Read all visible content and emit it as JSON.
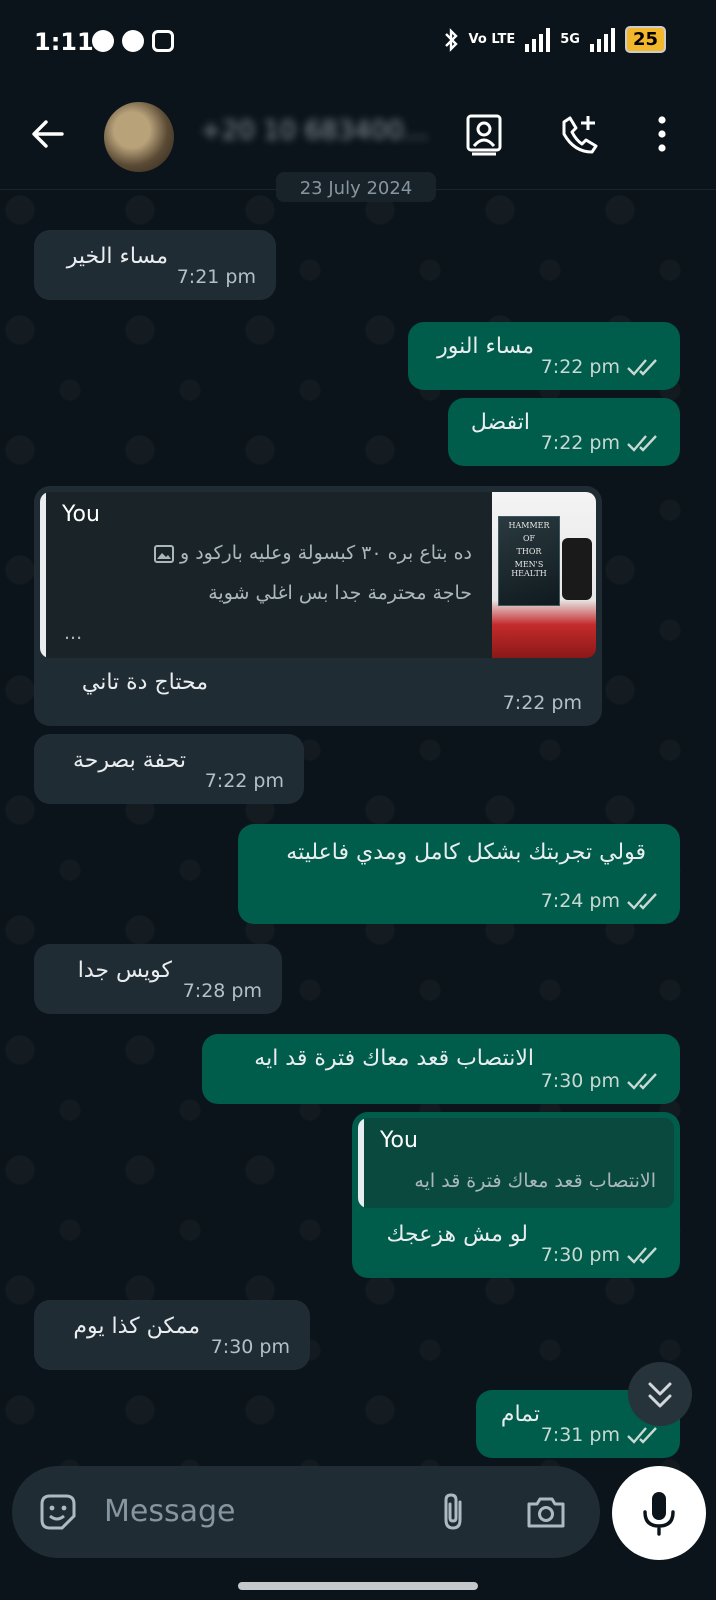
{
  "status_bar": {
    "time": "1:11",
    "network": "Vo LTE",
    "signal_5g": "5G",
    "battery": "25"
  },
  "header": {
    "contact_name": "+20 10 683400...",
    "back_icon": "arrow-left-icon",
    "icons": [
      "contact-card-icon",
      "add-call-icon",
      "more-vert-icon"
    ]
  },
  "date_chip": "23 July 2024",
  "messages": [
    {
      "dir": "in",
      "text": "مساء الخير",
      "time": "7:21 pm"
    },
    {
      "dir": "out",
      "text": "مساء النور",
      "time": "7:22 pm"
    },
    {
      "dir": "out",
      "text": "اتفضل",
      "time": "7:22 pm"
    },
    {
      "dir": "in",
      "quote_author": "You",
      "quote_line1": "ده بتاع بره ٣٠ كبسولة وعليه باركود و",
      "quote_line2": "حاجة محترمة جدا بس اغلي شوية",
      "quote_more": "...",
      "text": "محتاج دة تاني",
      "time": "7:22 pm"
    },
    {
      "dir": "in",
      "text": "تحفة بصرحة",
      "time": "7:22 pm"
    },
    {
      "dir": "out",
      "text": "قولي تجربتك بشكل كامل ومدي فاعليته",
      "time": "7:24 pm"
    },
    {
      "dir": "in",
      "text": "كويس جدا",
      "time": "7:28 pm"
    },
    {
      "dir": "out",
      "text": "الانتصاب قعد معاك فترة قد ايه",
      "time": "7:30 pm"
    },
    {
      "dir": "out",
      "quote_author": "You",
      "quote_line1": "الانتصاب قعد معاك فترة قد ايه",
      "text": "لو مش هزعجك",
      "time": "7:30 pm"
    },
    {
      "dir": "in",
      "text": "ممكن كذا يوم",
      "time": "7:30 pm"
    },
    {
      "dir": "out",
      "text": "تمام",
      "time": "7:31 pm"
    }
  ],
  "product_thumb": {
    "line1": "HAMMER",
    "line2": "OF",
    "line3": "THOR",
    "line4": "MEN'S HEALTH"
  },
  "composer": {
    "placeholder": "Message"
  },
  "colors": {
    "incoming": "#202c33",
    "outgoing": "#005c4b",
    "background": "#0b141a"
  }
}
